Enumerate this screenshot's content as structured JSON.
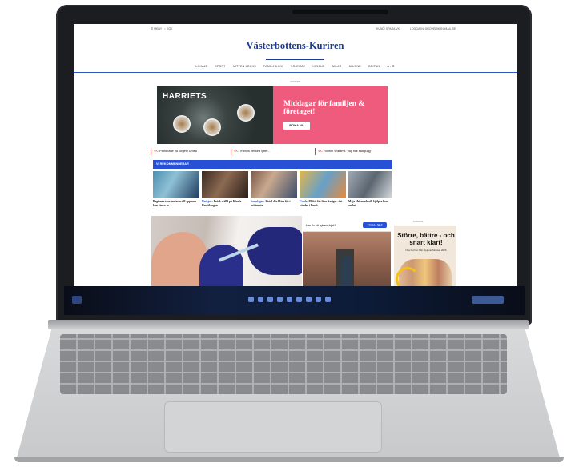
{
  "site": {
    "title": "Västerbottens-Kuriren",
    "topbar": {
      "menu_label": "MENY",
      "search_label": "SÖK",
      "account_label": "KUND/ SPARA VK",
      "subscribe_label": "LOGGA IN/ GROVERIK@GMAIL.SE"
    },
    "nav": [
      "LOKALT",
      "SPORT",
      "MITTEN LOCKS",
      "FAMILJ & LIV",
      "NÖJE/TAV",
      "KULTUR",
      "MILJÖ",
      "MAINNE",
      "BRITAN",
      "A - Ö"
    ],
    "ad_label": "ANNONS",
    "banner": {
      "brand": "HARRIETS",
      "headline": "Middagar för familjen & företaget!",
      "cta": "BOKA NU"
    },
    "ticker": [
      {
        "tag": "VK:",
        "text": "Parkerade på torget i Umeå"
      },
      {
        "tag": "VK:",
        "text": "Trumps besked lyfter..."
      },
      {
        "tag": "VK:",
        "text": "Robbie Williams \"Jag fick skitbjugg\""
      }
    ],
    "recommend_title": "VI REKOMMENDERAR",
    "cards": [
      {
        "tag": "",
        "text": "Regionen tror anslaren till app som kan sänka år"
      },
      {
        "tag": "Umbjuv:",
        "text": "Fröck ställd på Klonfa Umeåkrogen"
      },
      {
        "tag": "Samslagen:",
        "text": "Pistol dör bläsa för i måltunste"
      },
      {
        "tag": "Guide:",
        "text": "Plakte för lönn Saeign - det känder i Umeå"
      },
      {
        "tag": "",
        "text": "Maja Helsevads vill kjölpre hon anslut"
      }
    ],
    "vote": {
      "question": "Har du ett vybesrubjet?",
      "button": "TYCKA - NEJ!"
    },
    "side_ad": {
      "label": "ANNONS",
      "headline": "Större, bättre - och snart klart!",
      "sub": "Nya Kuriren från Spjuvar Mossar 2026"
    }
  },
  "colors": {
    "brand_blue": "#1f3b8f",
    "accent_blue": "#2850d6",
    "banner_pink": "#ef5b7c",
    "ticker_red": "#d33333"
  }
}
